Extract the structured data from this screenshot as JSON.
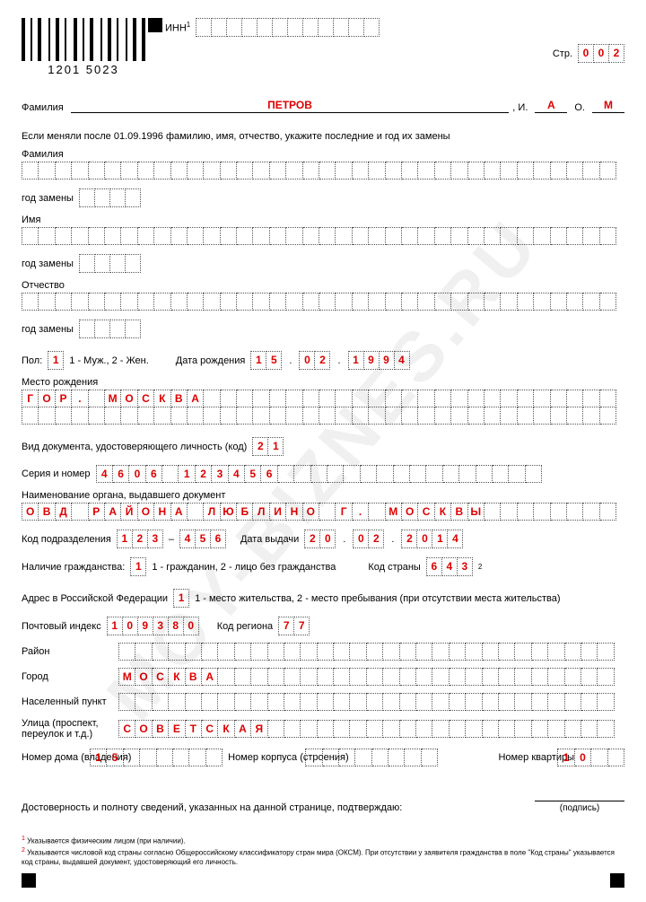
{
  "watermark": "MOY-BIZNES.RU",
  "header": {
    "barcode_text": "1201 5023",
    "inn_label": "ИНН",
    "inn_sup": "1",
    "inn": [
      "",
      "",
      "",
      "",
      "",
      "",
      "",
      "",
      "",
      "",
      "",
      ""
    ],
    "page_label": "Стр.",
    "page": [
      "0",
      "0",
      "2"
    ]
  },
  "fio": {
    "surname_label": "Фамилия",
    "surname": "ПЕТРОВ",
    "i_label": ", И.",
    "i": "А",
    "o_label": "О.",
    "o": "М"
  },
  "change_note": "Если меняли после 01.09.1996 фамилию, имя, отчество, укажите последние и год их замены",
  "prev": {
    "surname_label": "Фамилия",
    "surname": "",
    "surname_year_label": "год замены",
    "surname_year": [
      "",
      "",
      "",
      ""
    ],
    "name_label": "Имя",
    "name": "",
    "name_year_label": "год замены",
    "name_year": [
      "",
      "",
      "",
      ""
    ],
    "patronymic_label": "Отчество",
    "patronymic": "",
    "patronymic_year_label": "год замены",
    "patronymic_year": [
      "",
      "",
      "",
      ""
    ]
  },
  "sex": {
    "label": "Пол:",
    "value": [
      "1"
    ],
    "legend": "1 - Муж., 2 - Жен."
  },
  "dob": {
    "label": "Дата рождения",
    "d": [
      "1",
      "5"
    ],
    "m": [
      "0",
      "2"
    ],
    "y": [
      "1",
      "9",
      "9",
      "4"
    ]
  },
  "birthplace": {
    "label": "Место рождения",
    "line1": "ГОР. МОСКВА",
    "line2": ""
  },
  "doc": {
    "type_label": "Вид документа, удостоверяющего личность (код)",
    "type": [
      "2",
      "1"
    ],
    "sn_label": "Серия и номер",
    "sn": "4606 123456",
    "issuer_label": "Наименование органа, выдавшего документ",
    "issuer": "ОВД РАЙОНА ЛЮБЛИНО Г. МОСКВЫ",
    "dept_label": "Код подразделения",
    "dept1": [
      "1",
      "2",
      "3"
    ],
    "dept2": [
      "4",
      "5",
      "6"
    ],
    "issue_date_label": "Дата выдачи",
    "issue_d": [
      "2",
      "0"
    ],
    "issue_m": [
      "0",
      "2"
    ],
    "issue_y": [
      "2",
      "0",
      "1",
      "4"
    ]
  },
  "citizenship": {
    "label": "Наличие гражданства:",
    "value": [
      "1"
    ],
    "legend": "1 - гражданин, 2 - лицо без гражданства",
    "country_label": "Код страны",
    "country": [
      "6",
      "4",
      "3"
    ],
    "country_sup": "2"
  },
  "address": {
    "label": "Адрес в Российской Федерации",
    "value": [
      "1"
    ],
    "legend": "1 - место жительства, 2 - место пребывания (при отсутствии места жительства)",
    "zip_label": "Почтовый индекс",
    "zip": [
      "1",
      "0",
      "9",
      "3",
      "8",
      "0"
    ],
    "region_label": "Код региона",
    "region": [
      "7",
      "7"
    ],
    "district_label": "Район",
    "district": "",
    "city_label": "Город",
    "city": "МОСКВА",
    "locality_label": "Населенный пункт",
    "locality": "",
    "street_label": "Улица (проспект, переулок и т.д.)",
    "street": "СОВЕТСКАЯ",
    "house_label": "Номер дома (владения)",
    "house": "15",
    "building_label": "Номер корпуса (строения)",
    "building": "",
    "flat_label": "Номер квартиры",
    "flat": "10"
  },
  "confirm_text": "Достоверность и полноту сведений, указанных на данной странице, подтверждаю:",
  "sig_label": "(подпись)",
  "footnotes": {
    "f1_sup": "1",
    "f1": "Указывается физическим лицом (при наличии).",
    "f2_sup": "2",
    "f2": "Указывается числовой код страны согласно Общероссийскому классификатору стран мира (ОКСМ). При отсутствии у заявителя гражданства в поле \"Код страны\" указывается код страны, выдавшей документ, удостоверяющий его личность."
  }
}
